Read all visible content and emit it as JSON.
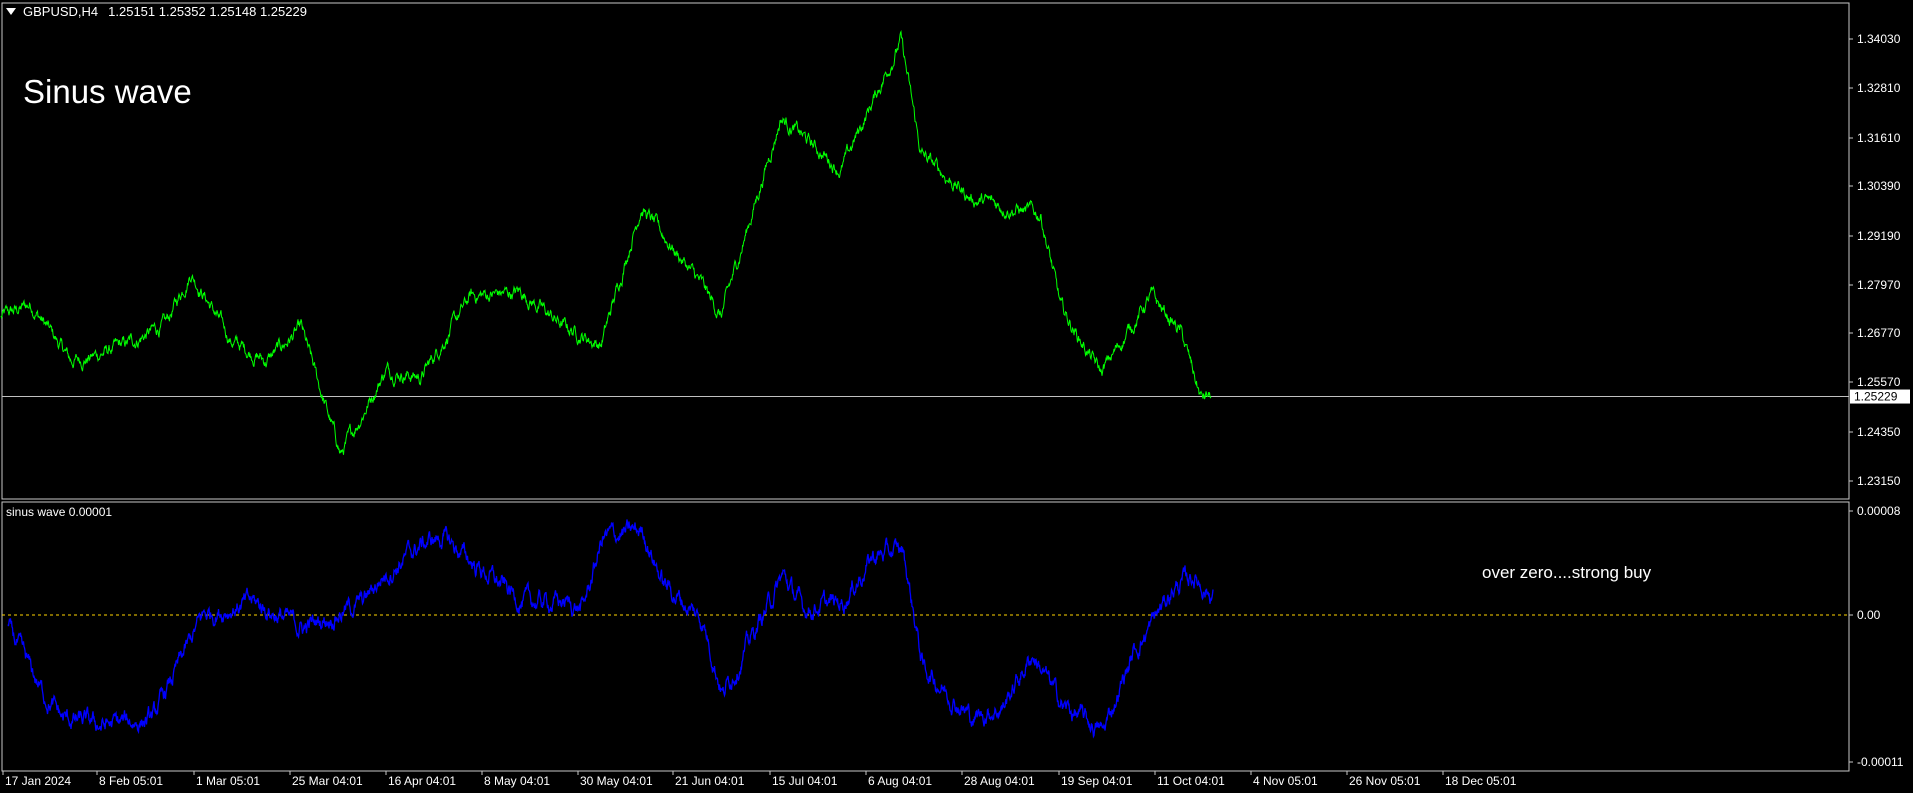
{
  "header": {
    "symbol": "GBPUSD,H4",
    "ohlc": "1.25151 1.25352 1.25148 1.25229"
  },
  "labels": {
    "title": "Sinus wave",
    "indicator_title": "sinus wave 0.00001",
    "annotation": "over zero....strong buy"
  },
  "colors": {
    "background": "#000000",
    "price_line": "#00ff00",
    "indicator_line": "#0000ff",
    "zero_line": "#ffd400",
    "grid_border": "#c8c8c8",
    "last_price_line": "#c0c0c0"
  },
  "chart_data": [
    {
      "type": "line",
      "title": "",
      "series": [
        {
          "name": "GBPUSD,H4",
          "color": "#00ff00"
        }
      ],
      "ylim": [
        1.2255,
        1.3436
      ],
      "yticks": [
        "1.34030",
        "1.32810",
        "1.31610",
        "1.30390",
        "1.29190",
        "1.27970",
        "1.26770",
        "1.25570",
        "1.24350",
        "1.23150"
      ],
      "last_price": "1.25229",
      "xticks": [
        "17 Jan 2024",
        "8 Feb 05:01",
        "1 Mar 05:01",
        "25 Mar 04:01",
        "16 Apr 04:01",
        "8 May 04:01",
        "30 May 04:01",
        "21 Jun 04:01",
        "15 Jul 04:01",
        "6 Aug 04:01",
        "28 Aug 04:01",
        "19 Sep 04:01",
        "11 Oct 04:01",
        "4 Nov 05:01",
        "26 Nov 05:01",
        "18 Dec 05:01"
      ],
      "anchors": {
        "x": [
          0,
          30,
          70,
          90,
          125,
          165,
          190,
          230,
          265,
          300,
          340,
          385,
          420,
          470,
          520,
          560,
          600,
          640,
          700,
          720,
          780,
          840,
          900,
          920,
          970,
          1040,
          1060,
          1100,
          1150,
          1180,
          1200,
          1210
        ],
        "y": [
          1.2718,
          1.275,
          1.261,
          1.262,
          1.265,
          1.27,
          1.283,
          1.266,
          1.261,
          1.269,
          1.238,
          1.259,
          1.257,
          1.277,
          1.278,
          1.27,
          1.265,
          1.299,
          1.28,
          1.272,
          1.321,
          1.308,
          1.34,
          1.312,
          1.301,
          1.297,
          1.274,
          1.258,
          1.277,
          1.268,
          1.252,
          1.2523
        ]
      }
    },
    {
      "type": "line",
      "title": "sinus wave 0.00001",
      "series": [
        {
          "name": "sinus wave",
          "color": "#0000ff"
        }
      ],
      "ylim": [
        -0.00011,
        8e-05
      ],
      "yticks": [
        "0.00008",
        "0.00",
        "-0.00011"
      ],
      "zero_line": 0,
      "anchors": {
        "x": [
          5,
          40,
          60,
          100,
          150,
          200,
          250,
          300,
          360,
          380,
          420,
          440,
          470,
          520,
          560,
          580,
          600,
          640,
          660,
          700,
          720,
          780,
          800,
          840,
          870,
          900,
          920,
          970,
          1000,
          1030,
          1060,
          1100,
          1130,
          1170,
          1190,
          1210
        ],
        "y": [
          -1e-05,
          -6e-05,
          -8e-05,
          -8.5e-05,
          -8e-05,
          0,
          1e-05,
          -1e-05,
          1e-05,
          3e-05,
          5.5e-05,
          6e-05,
          4e-05,
          1e-05,
          1e-05,
          5e-06,
          6e-05,
          6.5e-05,
          2.5e-05,
          -5e-06,
          -6e-05,
          3e-05,
          5e-06,
          1e-05,
          4.5e-05,
          5e-05,
          -4e-05,
          -8e-05,
          -7e-05,
          -3e-05,
          -7e-05,
          -9e-05,
          -3e-05,
          2e-05,
          3e-05,
          1.5e-05
        ]
      }
    }
  ]
}
